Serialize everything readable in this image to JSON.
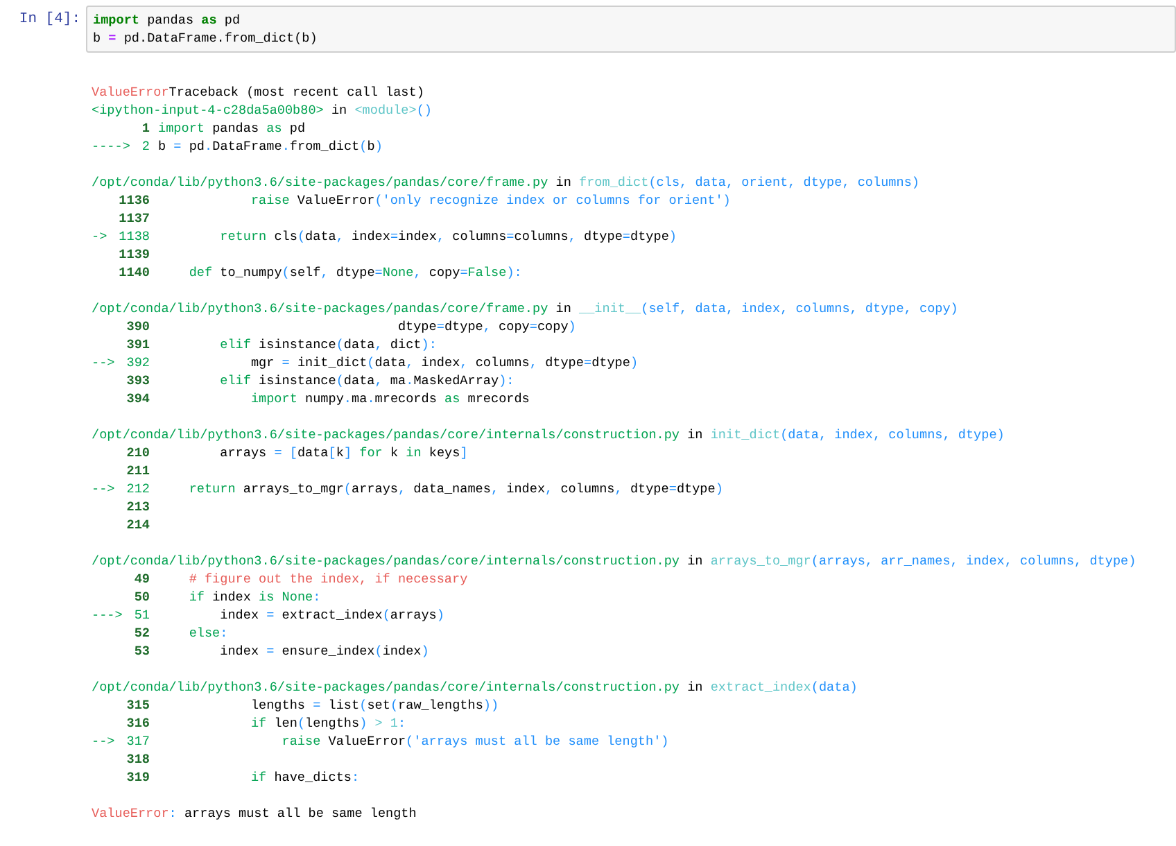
{
  "input_cell": {
    "prompt": "In [4]:",
    "lines": [
      [
        {
          "kind": "kw",
          "text": "import"
        },
        {
          "kind": "t",
          "text": " pandas "
        },
        {
          "kind": "kw",
          "text": "as"
        },
        {
          "kind": "t",
          "text": " pd"
        }
      ],
      [
        {
          "kind": "t",
          "text": "b "
        },
        {
          "kind": "op",
          "text": "="
        },
        {
          "kind": "t",
          "text": " pd.DataFrame.from_dict(b)"
        }
      ]
    ]
  },
  "output": {
    "header": [
      {
        "kind": "r",
        "text": "ValueError"
      },
      {
        "kind": "t",
        "text": "Traceback (most recent call last)"
      }
    ],
    "frames": [
      {
        "location": [
          {
            "kind": "g",
            "text": "<ipython-input-4-c28da5a00b80>"
          },
          {
            "kind": "t",
            "text": " in "
          },
          {
            "kind": "c",
            "text": "<module>"
          },
          {
            "kind": "b",
            "text": "()"
          }
        ],
        "rows": [
          {
            "number": "1",
            "current": false,
            "code": [
              {
                "kind": "g",
                "text": "import"
              },
              {
                "kind": "t",
                "text": " pandas "
              },
              {
                "kind": "g",
                "text": "as"
              },
              {
                "kind": "t",
                "text": " pd"
              }
            ]
          },
          {
            "arrow": "---->",
            "number": "2",
            "current": true,
            "code": [
              {
                "kind": "t",
                "text": "b "
              },
              {
                "kind": "b",
                "text": "="
              },
              {
                "kind": "t",
                "text": " pd"
              },
              {
                "kind": "b",
                "text": "."
              },
              {
                "kind": "t",
                "text": "DataFrame"
              },
              {
                "kind": "b",
                "text": "."
              },
              {
                "kind": "t",
                "text": "from_dict"
              },
              {
                "kind": "b",
                "text": "("
              },
              {
                "kind": "t",
                "text": "b"
              },
              {
                "kind": "b",
                "text": ")"
              }
            ]
          }
        ]
      },
      {
        "location": [
          {
            "kind": "g",
            "text": "/opt/conda/lib/python3.6/site-packages/pandas/core/frame.py"
          },
          {
            "kind": "t",
            "text": " in "
          },
          {
            "kind": "c",
            "text": "from_dict"
          },
          {
            "kind": "b",
            "text": "(cls, data, orient, dtype, columns)"
          }
        ],
        "rows": [
          {
            "number": "1136",
            "current": false,
            "code": [
              {
                "kind": "g",
                "text": "            raise"
              },
              {
                "kind": "t",
                "text": " ValueError"
              },
              {
                "kind": "b",
                "text": "('only recognize index or columns for orient')"
              }
            ]
          },
          {
            "number": "1137",
            "current": false
          },
          {
            "arrow": "->",
            "number": "1138",
            "current": true,
            "code": [
              {
                "kind": "g",
                "text": "        return"
              },
              {
                "kind": "t",
                "text": " cls"
              },
              {
                "kind": "b",
                "text": "("
              },
              {
                "kind": "t",
                "text": "data"
              },
              {
                "kind": "b",
                "text": ", "
              },
              {
                "kind": "t",
                "text": "index"
              },
              {
                "kind": "b",
                "text": "="
              },
              {
                "kind": "t",
                "text": "index"
              },
              {
                "kind": "b",
                "text": ", "
              },
              {
                "kind": "t",
                "text": "columns"
              },
              {
                "kind": "b",
                "text": "="
              },
              {
                "kind": "t",
                "text": "columns"
              },
              {
                "kind": "b",
                "text": ", "
              },
              {
                "kind": "t",
                "text": "dtype"
              },
              {
                "kind": "b",
                "text": "="
              },
              {
                "kind": "t",
                "text": "dtype"
              },
              {
                "kind": "b",
                "text": ")"
              }
            ]
          },
          {
            "number": "1139",
            "current": false
          },
          {
            "number": "1140",
            "current": false,
            "code": [
              {
                "kind": "g",
                "text": "    def"
              },
              {
                "kind": "t",
                "text": " to_numpy"
              },
              {
                "kind": "b",
                "text": "("
              },
              {
                "kind": "t",
                "text": "self"
              },
              {
                "kind": "b",
                "text": ", "
              },
              {
                "kind": "t",
                "text": "dtype"
              },
              {
                "kind": "b",
                "text": "="
              },
              {
                "kind": "g",
                "text": "None"
              },
              {
                "kind": "b",
                "text": ", "
              },
              {
                "kind": "t",
                "text": "copy"
              },
              {
                "kind": "b",
                "text": "="
              },
              {
                "kind": "g",
                "text": "False"
              },
              {
                "kind": "b",
                "text": "):"
              }
            ]
          }
        ]
      },
      {
        "location": [
          {
            "kind": "g",
            "text": "/opt/conda/lib/python3.6/site-packages/pandas/core/frame.py"
          },
          {
            "kind": "t",
            "text": " in "
          },
          {
            "kind": "c",
            "text": "__init__"
          },
          {
            "kind": "b",
            "text": "(self, data, index, columns, dtype, copy)"
          }
        ],
        "rows": [
          {
            "number": "390",
            "current": false,
            "code": [
              {
                "kind": "t",
                "text": "                               dtype"
              },
              {
                "kind": "b",
                "text": "="
              },
              {
                "kind": "t",
                "text": "dtype"
              },
              {
                "kind": "b",
                "text": ", "
              },
              {
                "kind": "t",
                "text": "copy"
              },
              {
                "kind": "b",
                "text": "="
              },
              {
                "kind": "t",
                "text": "copy"
              },
              {
                "kind": "b",
                "text": ")"
              }
            ]
          },
          {
            "number": "391",
            "current": false,
            "code": [
              {
                "kind": "g",
                "text": "        elif"
              },
              {
                "kind": "t",
                "text": " isinstance"
              },
              {
                "kind": "b",
                "text": "("
              },
              {
                "kind": "t",
                "text": "data"
              },
              {
                "kind": "b",
                "text": ", "
              },
              {
                "kind": "t",
                "text": "dict"
              },
              {
                "kind": "b",
                "text": "):"
              }
            ]
          },
          {
            "arrow": "-->",
            "number": "392",
            "current": true,
            "code": [
              {
                "kind": "t",
                "text": "            mgr "
              },
              {
                "kind": "b",
                "text": "="
              },
              {
                "kind": "t",
                "text": " init_dict"
              },
              {
                "kind": "b",
                "text": "("
              },
              {
                "kind": "t",
                "text": "data"
              },
              {
                "kind": "b",
                "text": ", "
              },
              {
                "kind": "t",
                "text": "index"
              },
              {
                "kind": "b",
                "text": ", "
              },
              {
                "kind": "t",
                "text": "columns"
              },
              {
                "kind": "b",
                "text": ", "
              },
              {
                "kind": "t",
                "text": "dtype"
              },
              {
                "kind": "b",
                "text": "="
              },
              {
                "kind": "t",
                "text": "dtype"
              },
              {
                "kind": "b",
                "text": ")"
              }
            ]
          },
          {
            "number": "393",
            "current": false,
            "code": [
              {
                "kind": "g",
                "text": "        elif"
              },
              {
                "kind": "t",
                "text": " isinstance"
              },
              {
                "kind": "b",
                "text": "("
              },
              {
                "kind": "t",
                "text": "data"
              },
              {
                "kind": "b",
                "text": ", "
              },
              {
                "kind": "t",
                "text": "ma"
              },
              {
                "kind": "b",
                "text": "."
              },
              {
                "kind": "t",
                "text": "MaskedArray"
              },
              {
                "kind": "b",
                "text": "):"
              }
            ]
          },
          {
            "number": "394",
            "current": false,
            "code": [
              {
                "kind": "g",
                "text": "            import"
              },
              {
                "kind": "t",
                "text": " numpy"
              },
              {
                "kind": "b",
                "text": "."
              },
              {
                "kind": "t",
                "text": "ma"
              },
              {
                "kind": "b",
                "text": "."
              },
              {
                "kind": "t",
                "text": "mrecords "
              },
              {
                "kind": "g",
                "text": "as"
              },
              {
                "kind": "t",
                "text": " mrecords"
              }
            ]
          }
        ]
      },
      {
        "location": [
          {
            "kind": "g",
            "text": "/opt/conda/lib/python3.6/site-packages/pandas/core/internals/construction.py"
          },
          {
            "kind": "t",
            "text": " in "
          },
          {
            "kind": "c",
            "text": "init_dict"
          },
          {
            "kind": "b",
            "text": "(data, index, columns, dtype)"
          }
        ],
        "rows": [
          {
            "number": "210",
            "current": false,
            "code": [
              {
                "kind": "t",
                "text": "        arrays "
              },
              {
                "kind": "b",
                "text": "= ["
              },
              {
                "kind": "t",
                "text": "data"
              },
              {
                "kind": "b",
                "text": "["
              },
              {
                "kind": "t",
                "text": "k"
              },
              {
                "kind": "b",
                "text": "] "
              },
              {
                "kind": "g",
                "text": "for"
              },
              {
                "kind": "t",
                "text": " k "
              },
              {
                "kind": "g",
                "text": "in"
              },
              {
                "kind": "t",
                "text": " keys"
              },
              {
                "kind": "b",
                "text": "]"
              }
            ]
          },
          {
            "number": "211",
            "current": false
          },
          {
            "arrow": "-->",
            "number": "212",
            "current": true,
            "code": [
              {
                "kind": "g",
                "text": "    return"
              },
              {
                "kind": "t",
                "text": " arrays_to_mgr"
              },
              {
                "kind": "b",
                "text": "("
              },
              {
                "kind": "t",
                "text": "arrays"
              },
              {
                "kind": "b",
                "text": ", "
              },
              {
                "kind": "t",
                "text": "data_names"
              },
              {
                "kind": "b",
                "text": ", "
              },
              {
                "kind": "t",
                "text": "index"
              },
              {
                "kind": "b",
                "text": ", "
              },
              {
                "kind": "t",
                "text": "columns"
              },
              {
                "kind": "b",
                "text": ", "
              },
              {
                "kind": "t",
                "text": "dtype"
              },
              {
                "kind": "b",
                "text": "="
              },
              {
                "kind": "t",
                "text": "dtype"
              },
              {
                "kind": "b",
                "text": ")"
              }
            ]
          },
          {
            "number": "213",
            "current": false
          },
          {
            "number": "214",
            "current": false
          }
        ]
      },
      {
        "location": [
          {
            "kind": "g",
            "text": "/opt/conda/lib/python3.6/site-packages/pandas/core/internals/construction.py"
          },
          {
            "kind": "t",
            "text": " in "
          },
          {
            "kind": "c",
            "text": "arrays_to_mgr"
          },
          {
            "kind": "b",
            "text": "(arrays, arr_names, index, columns, dtype)"
          }
        ],
        "rows": [
          {
            "number": "49",
            "current": false,
            "code": [
              {
                "kind": "r",
                "text": "    # figure out the index, if necessary"
              }
            ]
          },
          {
            "number": "50",
            "current": false,
            "code": [
              {
                "kind": "g",
                "text": "    if"
              },
              {
                "kind": "t",
                "text": " index "
              },
              {
                "kind": "g",
                "text": "is None"
              },
              {
                "kind": "b",
                "text": ":"
              }
            ]
          },
          {
            "arrow": "--->",
            "number": "51",
            "current": true,
            "code": [
              {
                "kind": "t",
                "text": "        index "
              },
              {
                "kind": "b",
                "text": "="
              },
              {
                "kind": "t",
                "text": " extract_index"
              },
              {
                "kind": "b",
                "text": "("
              },
              {
                "kind": "t",
                "text": "arrays"
              },
              {
                "kind": "b",
                "text": ")"
              }
            ]
          },
          {
            "number": "52",
            "current": false,
            "code": [
              {
                "kind": "g",
                "text": "    else"
              },
              {
                "kind": "b",
                "text": ":"
              }
            ]
          },
          {
            "number": "53",
            "current": false,
            "code": [
              {
                "kind": "t",
                "text": "        index "
              },
              {
                "kind": "b",
                "text": "="
              },
              {
                "kind": "t",
                "text": " ensure_index"
              },
              {
                "kind": "b",
                "text": "("
              },
              {
                "kind": "t",
                "text": "index"
              },
              {
                "kind": "b",
                "text": ")"
              }
            ]
          }
        ]
      },
      {
        "location": [
          {
            "kind": "g",
            "text": "/opt/conda/lib/python3.6/site-packages/pandas/core/internals/construction.py"
          },
          {
            "kind": "t",
            "text": " in "
          },
          {
            "kind": "c",
            "text": "extract_index"
          },
          {
            "kind": "b",
            "text": "(data)"
          }
        ],
        "rows": [
          {
            "number": "315",
            "current": false,
            "code": [
              {
                "kind": "t",
                "text": "            lengths "
              },
              {
                "kind": "b",
                "text": "="
              },
              {
                "kind": "t",
                "text": " list"
              },
              {
                "kind": "b",
                "text": "("
              },
              {
                "kind": "t",
                "text": "set"
              },
              {
                "kind": "b",
                "text": "("
              },
              {
                "kind": "t",
                "text": "raw_lengths"
              },
              {
                "kind": "b",
                "text": "))"
              }
            ]
          },
          {
            "number": "316",
            "current": false,
            "code": [
              {
                "kind": "g",
                "text": "            if"
              },
              {
                "kind": "t",
                "text": " len"
              },
              {
                "kind": "b",
                "text": "("
              },
              {
                "kind": "t",
                "text": "lengths"
              },
              {
                "kind": "b",
                "text": ") "
              },
              {
                "kind": "c",
                "text": "> 1"
              },
              {
                "kind": "b",
                "text": ":"
              }
            ]
          },
          {
            "arrow": "-->",
            "number": "317",
            "current": true,
            "code": [
              {
                "kind": "g",
                "text": "                raise"
              },
              {
                "kind": "t",
                "text": " ValueError"
              },
              {
                "kind": "b",
                "text": "('arrays must all be same length')"
              }
            ]
          },
          {
            "number": "318",
            "current": false
          },
          {
            "number": "319",
            "current": false,
            "code": [
              {
                "kind": "g",
                "text": "            if"
              },
              {
                "kind": "t",
                "text": " have_dicts"
              },
              {
                "kind": "b",
                "text": ":"
              }
            ]
          }
        ]
      }
    ],
    "error": [
      {
        "kind": "r",
        "text": "ValueError"
      },
      {
        "kind": "b",
        "text": ":"
      },
      {
        "kind": "t",
        "text": " arrays must all be same length"
      }
    ]
  }
}
